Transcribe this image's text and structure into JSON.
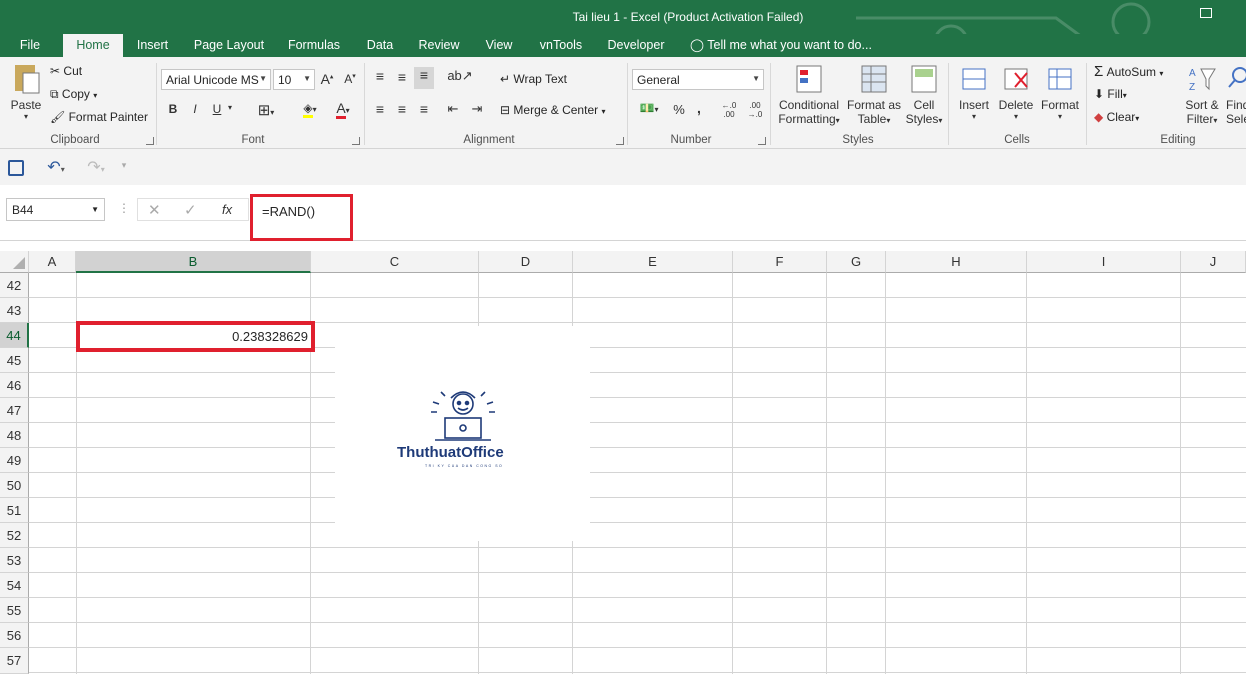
{
  "window": {
    "title": "Tai lieu 1 - Excel (Product Activation Failed)"
  },
  "menu": [
    "File",
    "Home",
    "Insert",
    "Page Layout",
    "Formulas",
    "Data",
    "Review",
    "View",
    "vnTools",
    "Developer"
  ],
  "tell_me": "Tell me what you want to do...",
  "clipboard": {
    "paste": "Paste",
    "cut": "Cut",
    "copy": "Copy",
    "format_painter": "Format Painter",
    "label": "Clipboard"
  },
  "font": {
    "name": "Arial Unicode MS",
    "size": "10",
    "bold": "B",
    "italic": "I",
    "underline": "U",
    "label": "Font"
  },
  "alignment": {
    "wrap": "Wrap Text",
    "merge": "Merge & Center",
    "label": "Alignment"
  },
  "number": {
    "format": "General",
    "percent": "%",
    "comma": ",",
    "inc_dec": "←.0 .00",
    "dec_dec": ".00 →.0",
    "label": "Number"
  },
  "styles": {
    "conditional_1": "Conditional",
    "conditional_2": "Formatting",
    "table_1": "Format as",
    "table_2": "Table",
    "cell_1": "Cell",
    "cell_2": "Styles",
    "label": "Styles"
  },
  "cells": {
    "insert": "Insert",
    "delete": "Delete",
    "format": "Format",
    "label": "Cells"
  },
  "editing": {
    "autosum": "AutoSum",
    "fill": "Fill",
    "clear": "Clear",
    "sort_1": "Sort &",
    "sort_2": "Filter",
    "find_1": "Find",
    "find_2": "Sele",
    "label": "Editing"
  },
  "name_box": "B44",
  "formula": "=RAND()",
  "fx": "fx",
  "columns": [
    "A",
    "B",
    "C",
    "D",
    "E",
    "F",
    "G",
    "H",
    "I",
    "J"
  ],
  "rows": [
    "42",
    "43",
    "44",
    "45",
    "46",
    "47",
    "48",
    "49",
    "50",
    "51",
    "52",
    "53",
    "54",
    "55",
    "56",
    "57"
  ],
  "active_value": "0.238328629",
  "logo": {
    "name": "ThuthuatOffice",
    "tagline": "TRI KY CUA DAN CONG SO"
  },
  "colors": {
    "excel_green": "#217346",
    "highlight_red": "#e0202e",
    "logo_blue": "#1e3a78"
  }
}
